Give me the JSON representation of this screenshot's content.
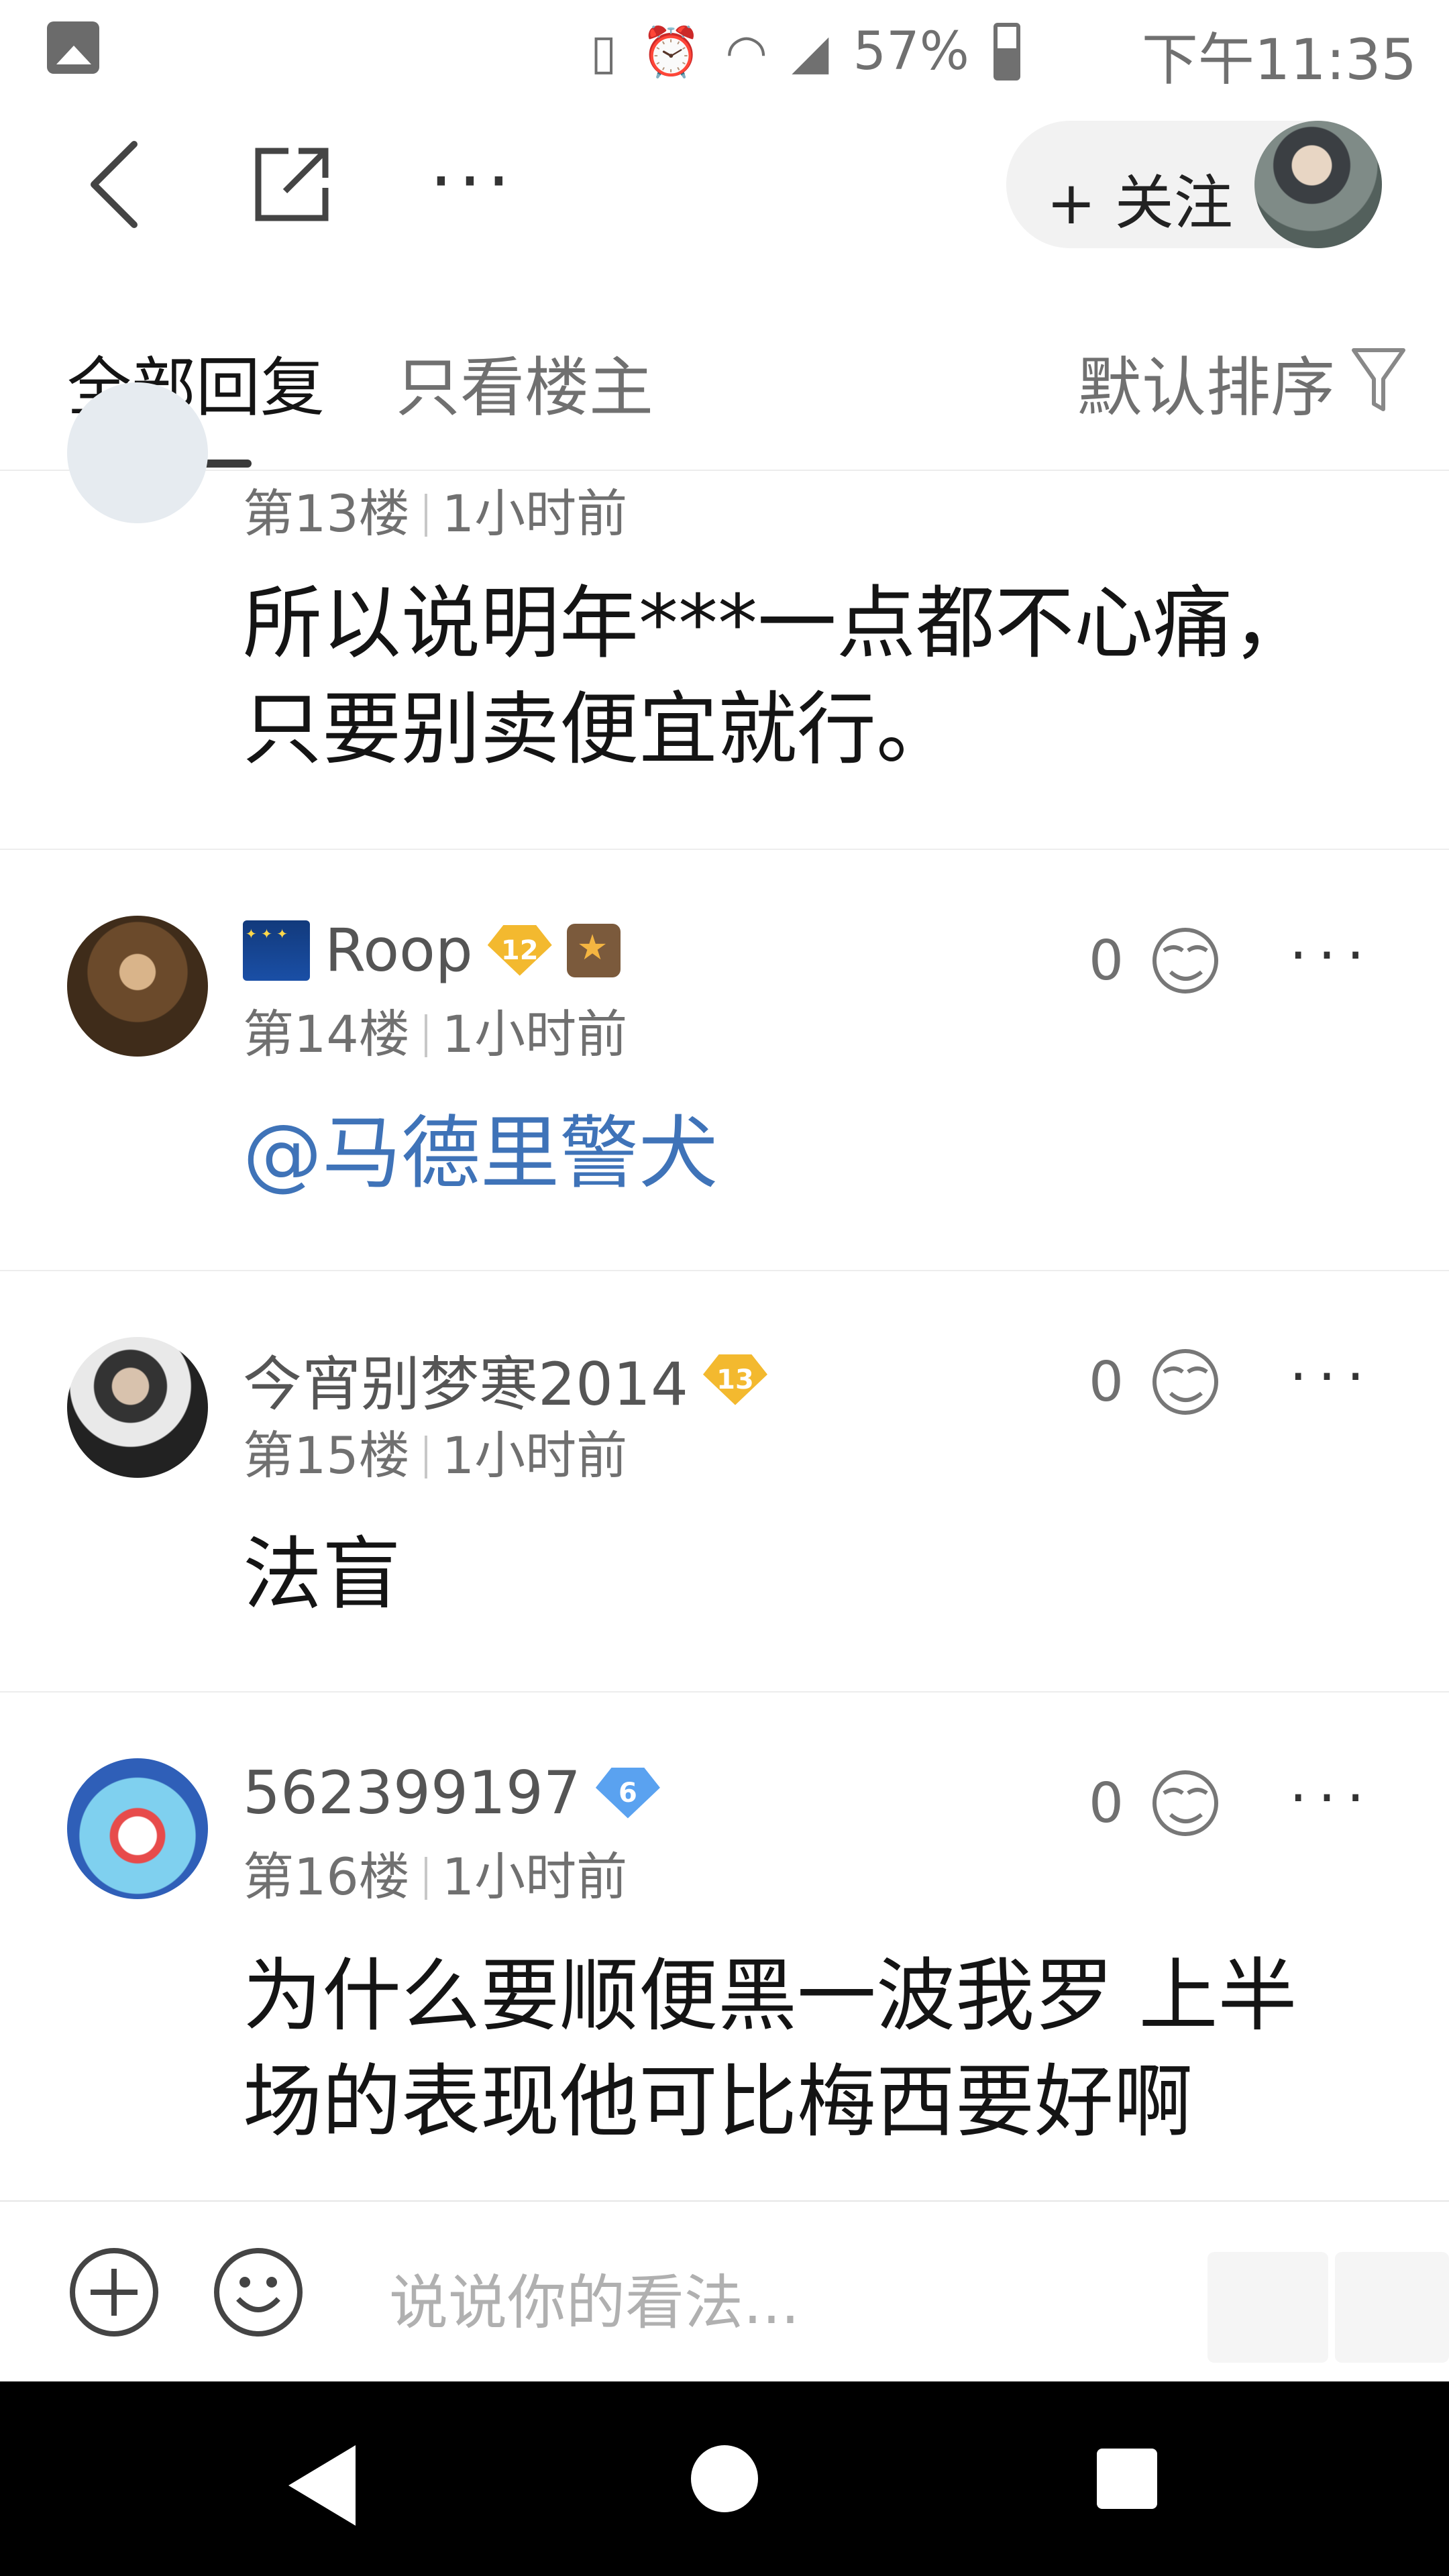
{
  "status_bar": {
    "battery": "57%",
    "time": "下午11:35",
    "icons": [
      "image-icon",
      "vibrate-icon",
      "alarm-icon",
      "wifi-icon",
      "signal-icon",
      "battery-icon"
    ]
  },
  "top_nav": {
    "follow_label": "+ 关注",
    "icons": [
      "back-arrow-icon",
      "share-icon",
      "more-icon"
    ]
  },
  "tabs": {
    "all_replies": "全部回复",
    "op_only": "只看楼主",
    "sort_label": "默认排序"
  },
  "comments": [
    {
      "floor": "第13楼",
      "time": "1小时前",
      "text": "所以说明年***一点都不心痛，只要别卖便宜就行。"
    },
    {
      "username": "Roop",
      "level": "12",
      "floor": "第14楼",
      "time": "1小时前",
      "likes": "0",
      "text": "@马德里警犬"
    },
    {
      "username": "今宵别梦寒2014",
      "level": "13",
      "floor": "第15楼",
      "time": "1小时前",
      "likes": "0",
      "text": "法盲"
    },
    {
      "username": "562399197",
      "level": "6",
      "floor": "第16楼",
      "time": "1小时前",
      "likes": "0",
      "text": "为什么要顺便黑一波我罗 上半场的表现他可比梅西要好啊"
    }
  ],
  "input_bar": {
    "placeholder": "说说你的看法..."
  },
  "colors": {
    "mention": "#3f73b8",
    "level_gold": "#f3b92f",
    "level_blue": "#5aa2f0",
    "secondary_text": "#707070"
  }
}
